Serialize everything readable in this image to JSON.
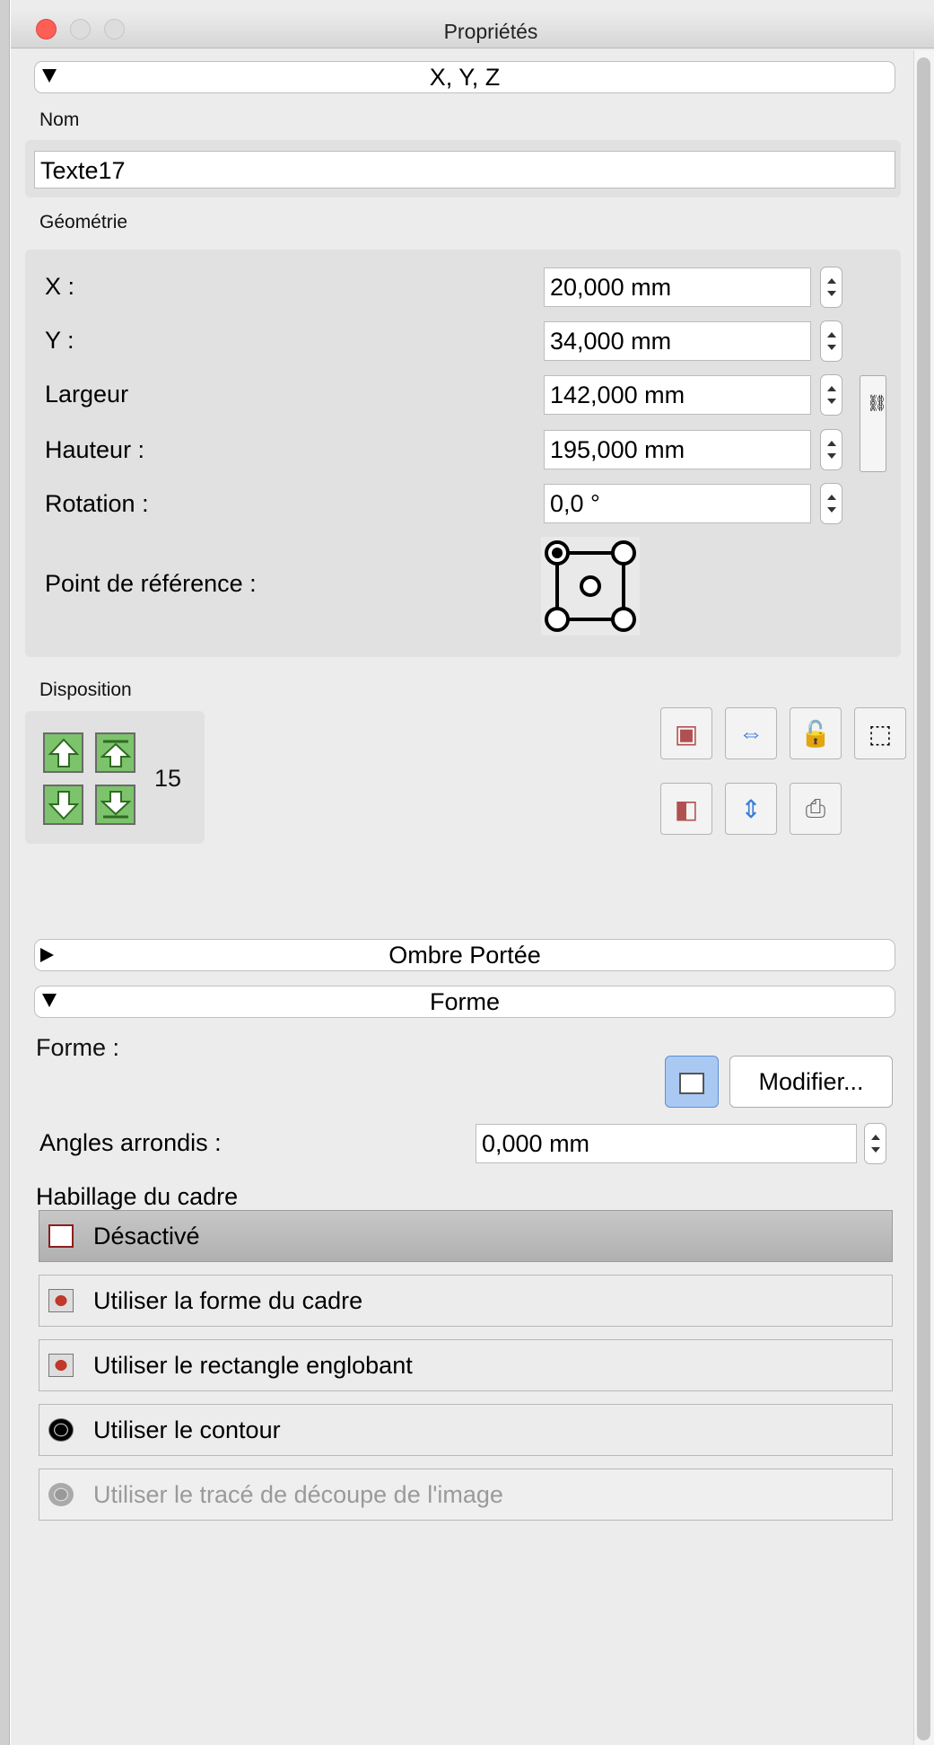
{
  "window": {
    "title": "Propriétés"
  },
  "sections": {
    "xyz": "X, Y, Z",
    "shadow": "Ombre Portée",
    "shape": "Forme"
  },
  "name": {
    "label": "Nom",
    "value": "Texte17"
  },
  "geometry": {
    "label": "Géométrie",
    "x": {
      "label": "X :",
      "value": "20,000 mm"
    },
    "y": {
      "label": "Y :",
      "value": "34,000 mm"
    },
    "width": {
      "label": "Largeur",
      "value": "142,000 mm"
    },
    "height": {
      "label": "Hauteur :",
      "value": "195,000 mm"
    },
    "rotation": {
      "label": "Rotation :",
      "value": "0,0 °"
    },
    "reference_point": {
      "label": "Point de référence :"
    }
  },
  "arrangement": {
    "label": "Disposition",
    "level": "15"
  },
  "shape": {
    "label": "Forme :",
    "modify_button": "Modifier...",
    "rounded_corners": {
      "label": "Angles arrondis :",
      "value": "0,000 mm"
    }
  },
  "text_flow": {
    "label": "Habillage du cadre",
    "options": [
      {
        "label": "Désactivé",
        "selected": true,
        "enabled": true
      },
      {
        "label": "Utiliser la forme du cadre",
        "selected": false,
        "enabled": true
      },
      {
        "label": "Utiliser le rectangle englobant",
        "selected": false,
        "enabled": true
      },
      {
        "label": "Utiliser le contour",
        "selected": false,
        "enabled": true
      },
      {
        "label": "Utiliser le tracé de découpe de l'image",
        "selected": false,
        "enabled": false
      }
    ]
  }
}
